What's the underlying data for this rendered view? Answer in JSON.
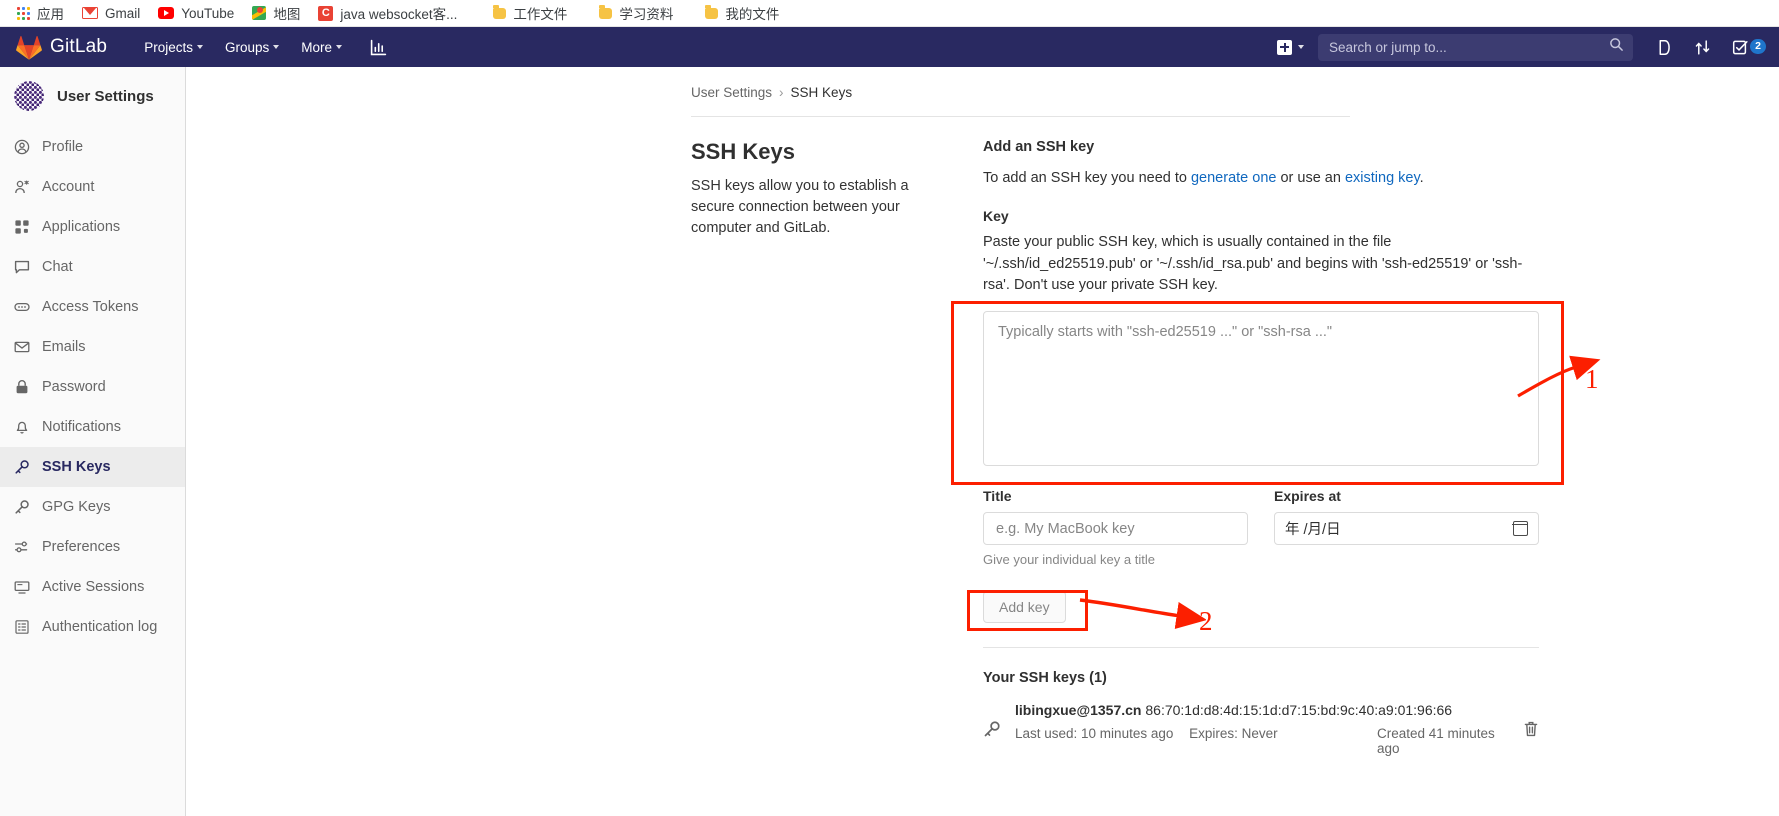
{
  "browser": {
    "bookmarks": [
      {
        "label": "应用",
        "icon": "apps-grid-icon"
      },
      {
        "label": "Gmail",
        "icon": "gmail-icon"
      },
      {
        "label": "YouTube",
        "icon": "youtube-icon"
      },
      {
        "label": "地图",
        "icon": "google-maps-icon"
      },
      {
        "label": "java websocket客...",
        "icon": "c-letter-icon"
      },
      {
        "label": "工作文件",
        "icon": "folder-icon"
      },
      {
        "label": "学习资料",
        "icon": "folder-icon"
      },
      {
        "label": "我的文件",
        "icon": "folder-icon"
      }
    ]
  },
  "navbar": {
    "brand": "GitLab",
    "items": [
      {
        "label": "Projects",
        "has_caret": true
      },
      {
        "label": "Groups",
        "has_caret": true
      },
      {
        "label": "More",
        "has_caret": true
      }
    ],
    "analytics_icon": "chart-bar-icon",
    "create_new_icon": "plus-square-icon",
    "search_placeholder": "Search or jump to...",
    "search_value": "",
    "search_icon": "search-icon",
    "issues_icon": "issues-icon",
    "merge_requests_icon": "merge-request-icon",
    "todos_icon": "todos-icon",
    "todos_count": "2",
    "accent": "#292961",
    "badge_color": "#1f75cb"
  },
  "sidebar": {
    "title": "User Settings",
    "avatar_icon": "user-avatar",
    "items": [
      {
        "label": "Profile",
        "icon": "user-circle-icon",
        "active": false
      },
      {
        "label": "Account",
        "icon": "account-gear-icon",
        "active": false
      },
      {
        "label": "Applications",
        "icon": "applications-grid-icon",
        "active": false
      },
      {
        "label": "Chat",
        "icon": "chat-bubble-icon",
        "active": false
      },
      {
        "label": "Access Tokens",
        "icon": "token-icon",
        "active": false
      },
      {
        "label": "Emails",
        "icon": "envelope-icon",
        "active": false
      },
      {
        "label": "Password",
        "icon": "lock-icon",
        "active": false
      },
      {
        "label": "Notifications",
        "icon": "bell-icon",
        "active": false
      },
      {
        "label": "SSH Keys",
        "icon": "key-icon",
        "active": true
      },
      {
        "label": "GPG Keys",
        "icon": "key-icon",
        "active": false
      },
      {
        "label": "Preferences",
        "icon": "sliders-icon",
        "active": false
      },
      {
        "label": "Active Sessions",
        "icon": "monitor-icon",
        "active": false
      },
      {
        "label": "Authentication log",
        "icon": "log-list-icon",
        "active": false
      }
    ]
  },
  "breadcrumb": {
    "parent": "User Settings",
    "separator": "›",
    "current": "SSH Keys"
  },
  "main": {
    "left": {
      "title": "SSH Keys",
      "description": "SSH keys allow you to establish a secure connection between your computer and GitLab."
    },
    "add_key": {
      "heading": "Add an SSH key",
      "intro_prefix": "To add an SSH key you need to ",
      "link_generate": "generate one",
      "intro_middle": " or use an ",
      "link_existing": "existing key",
      "intro_suffix": ".",
      "key_label": "Key",
      "key_hint": "Paste your public SSH key, which is usually contained in the file '~/.ssh/id_ed25519.pub' or '~/.ssh/id_rsa.pub' and begins with 'ssh-ed25519' or 'ssh-rsa'. Don't use your private SSH key.",
      "key_placeholder": "Typically starts with \"ssh-ed25519 ...\" or \"ssh-rsa ...\"",
      "key_value": "",
      "title_label": "Title",
      "title_placeholder": "e.g. My MacBook key",
      "title_value": "",
      "title_helper": "Give your individual key a title",
      "expires_label": "Expires at",
      "expires_value": "年 /月/日",
      "expires_icon": "calendar-icon",
      "submit_label": "Add key"
    },
    "keys_list": {
      "heading": "Your SSH keys (1)",
      "rows": [
        {
          "icon": "key-icon",
          "title": "libingxue@1357.cn",
          "fingerprint": "86:70:1d:d8:4d:15:1d:d7:15:bd:9c:40:a9:01:96:66",
          "last_used": "Last used: 10 minutes ago",
          "expires": "Expires: Never",
          "created": "Created 41 minutes ago",
          "delete_icon": "trash-icon"
        }
      ]
    }
  },
  "annotations": {
    "color": "#fc1f00",
    "marks": [
      {
        "number": "1",
        "target": "key-textarea"
      },
      {
        "number": "2",
        "target": "add-key-button"
      }
    ]
  }
}
